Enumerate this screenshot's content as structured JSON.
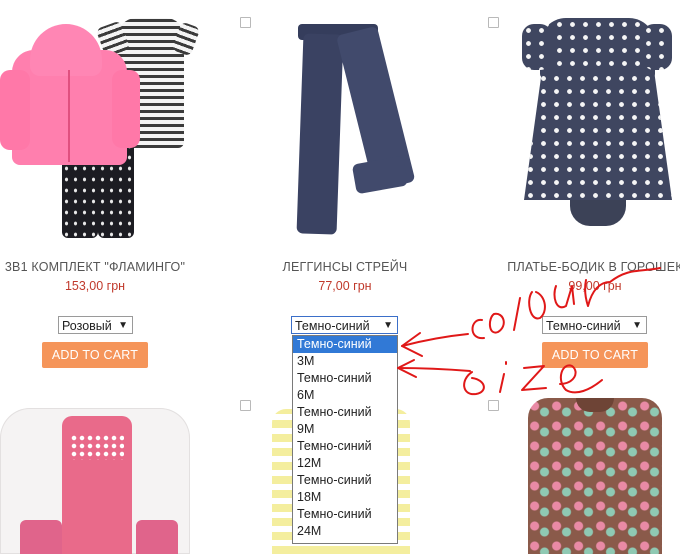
{
  "products": [
    {
      "title": "3В1 КОМПЛЕКТ \"ФЛАМИНГО\"",
      "price": "153,00 грн",
      "variant": "Розовый",
      "cart": "ADD TO CART"
    },
    {
      "title": "ЛЕГГИНСЫ СТРЕЙЧ",
      "price": "77,00 грн",
      "variant": "Темно-синий"
    },
    {
      "title": "ПЛАТЬЕ-БОДИК В ГОРОШЕК",
      "price": "99,00 грн",
      "variant": "Темно-синий",
      "cart": "ADD TO CART"
    }
  ],
  "dropdown_options": [
    "Темно-синий",
    "3M",
    "Темно-синий",
    "6M",
    "Темно-синий",
    "9M",
    "Темно-синий",
    "12M",
    "Темно-синий",
    "18M",
    "Темно-синий",
    "24M"
  ],
  "dropdown_selected_index": 0,
  "annotations": {
    "upper": "colour",
    "lower": "size",
    "color": "#e01818"
  },
  "colors": {
    "price": "#c0392b",
    "button": "#f5955a",
    "highlight": "#3179d6"
  }
}
